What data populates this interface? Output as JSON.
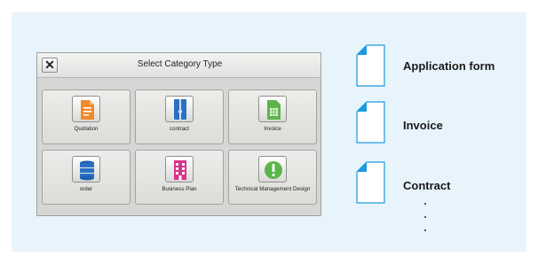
{
  "dialog": {
    "title": "Select Category Type",
    "close_label": "✕",
    "tiles": [
      {
        "label": "Quotation",
        "icon": "quotation-icon",
        "color": "#f08a2c"
      },
      {
        "label": "contract",
        "icon": "contract-icon",
        "color": "#2a6fc4"
      },
      {
        "label": "Invoice",
        "icon": "invoice-icon",
        "color": "#5cb54a"
      },
      {
        "label": "order",
        "icon": "order-icon",
        "color": "#2a6fc4"
      },
      {
        "label": "Business Plan",
        "icon": "business-plan-icon",
        "color": "#d8338c"
      },
      {
        "label": "Technical Management Design",
        "icon": "technical-icon",
        "color": "#5cb54a"
      }
    ]
  },
  "legend": {
    "items": [
      {
        "label": "Application form"
      },
      {
        "label": "Invoice"
      },
      {
        "label": "Contract"
      }
    ],
    "doc_color": "#1a9be0"
  },
  "colors": {
    "background": "#e8f4fb",
    "screen": "#d6d7d4"
  }
}
